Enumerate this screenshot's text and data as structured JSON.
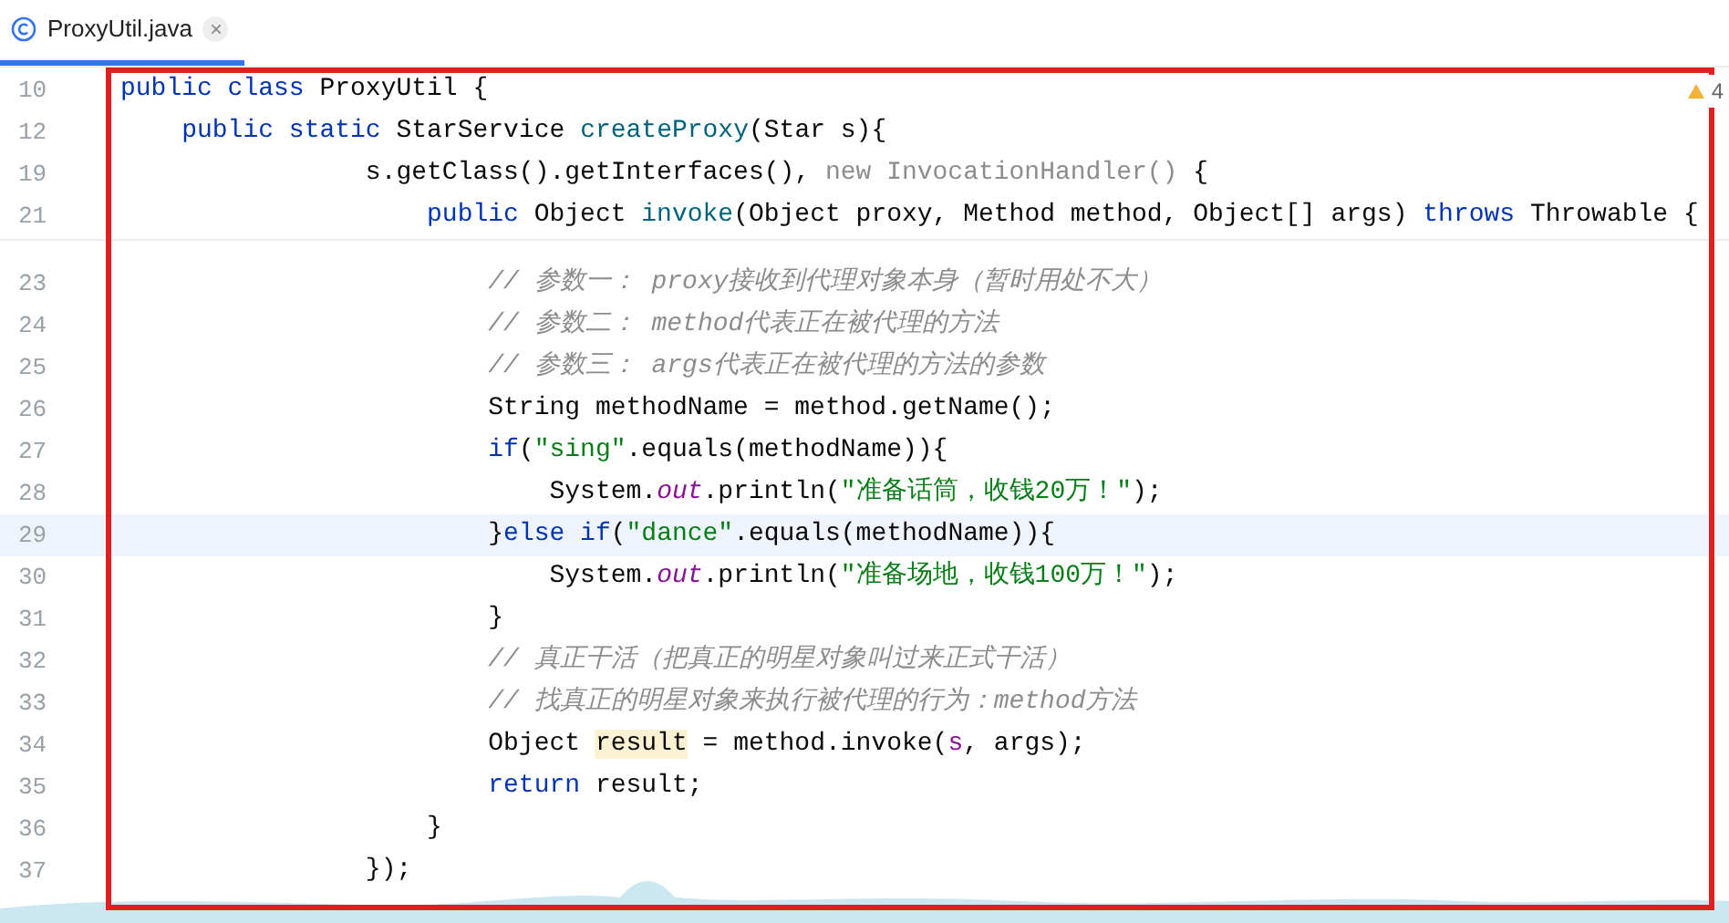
{
  "tabs": [
    {
      "label": "ProxyUtil.java",
      "close": "×",
      "selected": true
    }
  ],
  "warnings": {
    "count": "4"
  },
  "sticky_lines": [
    {
      "number": "10",
      "tokens": [
        {
          "text": "public class ",
          "kind": "keyword"
        },
        {
          "text": "ProxyUtil {",
          "kind": "plain"
        }
      ]
    },
    {
      "number": "12",
      "tokens": [
        {
          "text": "    public static ",
          "kind": "keyword"
        },
        {
          "text": "StarService ",
          "kind": "plain"
        },
        {
          "text": "createProxy",
          "kind": "method"
        },
        {
          "text": "(Star s){",
          "kind": "plain"
        }
      ]
    },
    {
      "number": "19",
      "tokens": [
        {
          "text": "                s.getClass().getInterfaces(), ",
          "kind": "plain"
        },
        {
          "text": "new InvocationHandler()",
          "kind": "muted"
        },
        {
          "text": " {",
          "kind": "plain"
        }
      ]
    },
    {
      "number": "21",
      "tokens": [
        {
          "text": "                    public ",
          "kind": "keyword"
        },
        {
          "text": "Object ",
          "kind": "plain"
        },
        {
          "text": "invoke",
          "kind": "method"
        },
        {
          "text": "(Object proxy, Method method, Object[] args) ",
          "kind": "plain"
        },
        {
          "text": "throws ",
          "kind": "keyword"
        },
        {
          "text": "Throwable {",
          "kind": "plain"
        }
      ]
    }
  ],
  "lines": [
    {
      "number": "23",
      "current": false,
      "tokens": [
        {
          "text": "                        // 参数一： proxy接收到代理对象本身（暂时用处不大）",
          "kind": "comment"
        }
      ]
    },
    {
      "number": "24",
      "current": false,
      "tokens": [
        {
          "text": "                        // 参数二： method代表正在被代理的方法",
          "kind": "comment"
        }
      ]
    },
    {
      "number": "25",
      "current": false,
      "tokens": [
        {
          "text": "                        // 参数三： args代表正在被代理的方法的参数",
          "kind": "comment"
        }
      ]
    },
    {
      "number": "26",
      "current": false,
      "tokens": [
        {
          "text": "                        String methodName = method.getName();",
          "kind": "plain"
        }
      ]
    },
    {
      "number": "27",
      "current": false,
      "tokens": [
        {
          "text": "                        if",
          "kind": "keyword"
        },
        {
          "text": "(",
          "kind": "plain"
        },
        {
          "text": "\"sing\"",
          "kind": "string"
        },
        {
          "text": ".equals(methodName)){",
          "kind": "plain"
        }
      ]
    },
    {
      "number": "28",
      "current": false,
      "tokens": [
        {
          "text": "                            System.",
          "kind": "plain"
        },
        {
          "text": "out",
          "kind": "field"
        },
        {
          "text": ".println(",
          "kind": "plain"
        },
        {
          "text": "\"准备话筒，收钱20万！\"",
          "kind": "string"
        },
        {
          "text": ");",
          "kind": "plain"
        }
      ]
    },
    {
      "number": "29",
      "current": true,
      "tokens": [
        {
          "text": "                        }",
          "kind": "plain"
        },
        {
          "text": "else if",
          "kind": "keyword"
        },
        {
          "text": "(",
          "kind": "plain"
        },
        {
          "text": "\"dance\"",
          "kind": "string"
        },
        {
          "text": ".equals(methodName)){",
          "kind": "plain"
        }
      ]
    },
    {
      "number": "30",
      "current": false,
      "tokens": [
        {
          "text": "                            System.",
          "kind": "plain"
        },
        {
          "text": "out",
          "kind": "field"
        },
        {
          "text": ".println(",
          "kind": "plain"
        },
        {
          "text": "\"准备场地，收钱100万！\"",
          "kind": "string"
        },
        {
          "text": ");",
          "kind": "plain"
        }
      ]
    },
    {
      "number": "31",
      "current": false,
      "tokens": [
        {
          "text": "                        }",
          "kind": "plain"
        }
      ]
    },
    {
      "number": "32",
      "current": false,
      "tokens": [
        {
          "text": "                        // 真正干活（把真正的明星对象叫过来正式干活）",
          "kind": "comment"
        }
      ]
    },
    {
      "number": "33",
      "current": false,
      "tokens": [
        {
          "text": "                        // 找真正的明星对象来执行被代理的行为：method方法",
          "kind": "comment"
        }
      ]
    },
    {
      "number": "34",
      "current": false,
      "tokens": [
        {
          "text": "                        Object ",
          "kind": "plain"
        },
        {
          "text": "result",
          "kind": "highlight"
        },
        {
          "text": " = method.invoke(",
          "kind": "plain"
        },
        {
          "text": "s",
          "kind": "param"
        },
        {
          "text": ", args);",
          "kind": "plain"
        }
      ]
    },
    {
      "number": "35",
      "current": false,
      "tokens": [
        {
          "text": "                        return ",
          "kind": "keyword"
        },
        {
          "text": "result;",
          "kind": "plain"
        }
      ]
    },
    {
      "number": "36",
      "current": false,
      "tokens": [
        {
          "text": "                    }",
          "kind": "plain"
        }
      ]
    },
    {
      "number": "37",
      "current": false,
      "tokens": [
        {
          "text": "                });",
          "kind": "plain"
        }
      ]
    }
  ]
}
